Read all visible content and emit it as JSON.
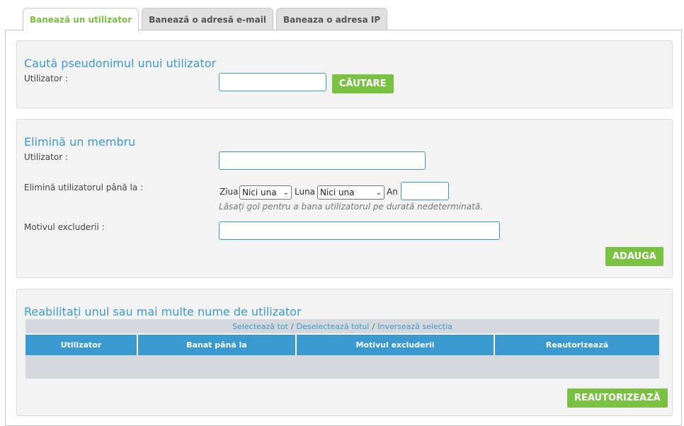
{
  "tabs": [
    {
      "label": "Banează un utilizator"
    },
    {
      "label": "Banează o adresă e-mail"
    },
    {
      "label": "Baneaza o adresa IP"
    }
  ],
  "search_section": {
    "title": "Caută pseudonimul unui utilizator",
    "user_label": "Utilizator :",
    "user_value": "",
    "search_button": "CĂUTARE"
  },
  "remove_section": {
    "title": "Elimină un membru",
    "user_label": "Utilizator :",
    "user_value": "",
    "until_label": "Elimină utilizatorul până la :",
    "day_label": "Ziua",
    "day_selected": "Nici una",
    "month_label": "Luna",
    "month_selected": "Nici una",
    "year_label": "An",
    "year_value": "",
    "hint": "Lăsați gol pentru a bana utilizatorul pe durată nedeterminată.",
    "reason_label": "Motivul excluderii :",
    "reason_value": "",
    "add_button": "ADAUGA"
  },
  "rehab_section": {
    "title": "Reabilitați unul sau mai multe nume de utilizator",
    "select_all": "Selectează tot",
    "deselect_all": "Deselectează totul",
    "invert": "Inversează selecția",
    "separator": "/",
    "columns": [
      "Utilizator",
      "Banat până la",
      "Motivul excluderii",
      "Reautorizează"
    ],
    "reauth_button": "REAUTORIZEAZĂ"
  },
  "colors": {
    "accent": "#3a9ad0",
    "button": "#7ac142"
  }
}
